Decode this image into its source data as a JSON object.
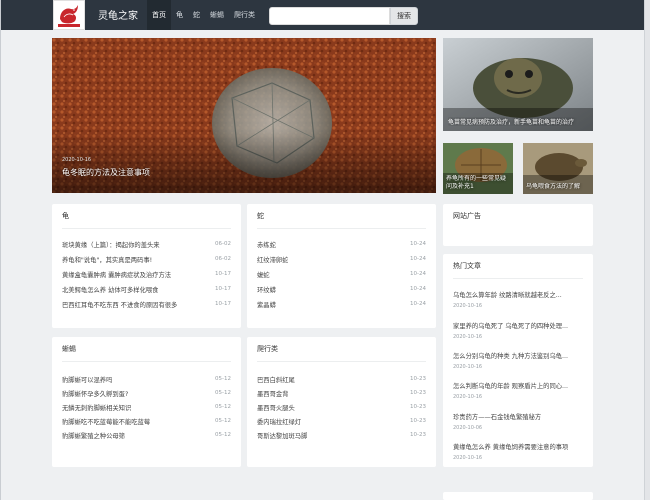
{
  "site": {
    "name": "灵龟之家",
    "logo_text": "灵龟之家"
  },
  "nav": {
    "items": [
      {
        "label": "首页",
        "active": true
      },
      {
        "label": "龟",
        "active": false
      },
      {
        "label": "蛇",
        "active": false
      },
      {
        "label": "蜥蜴",
        "active": false
      },
      {
        "label": "爬行类",
        "active": false
      }
    ]
  },
  "search": {
    "value": "",
    "placeholder": "",
    "button_label": "搜索"
  },
  "hero": {
    "date": "2020-10-16",
    "title": "龟冬眠的方法及注意事项"
  },
  "side_images": {
    "big": {
      "caption": "龟苗常见病预防及治疗，新手龟苗和龟苗的治疗"
    },
    "small_1": {
      "caption": "养龟所有的一些常见疑问及补充1"
    },
    "small_2": {
      "caption": "乌龟喂食方法的了解"
    }
  },
  "sections": {
    "turtle": {
      "title": "龟",
      "items": [
        {
          "title": "斑块黄缘（上篇）：揭起你的盖头来",
          "date": "06-02"
        },
        {
          "title": "养龟和\"说龟\"，其实真是两码事!",
          "date": "06-02"
        },
        {
          "title": "黄缘盒龟囊肿病 囊肿病症状及治疗方法",
          "date": "10-17"
        },
        {
          "title": "北美鳄龟怎么养 幼体可多样化喂食",
          "date": "10-17"
        },
        {
          "title": "巴西红耳龟不吃东西 不进食的原因有很多",
          "date": "10-17"
        }
      ]
    },
    "snake": {
      "title": "蛇",
      "items": [
        {
          "title": "赤练蛇",
          "date": "10-24"
        },
        {
          "title": "红纹滞卵蛇",
          "date": "10-24"
        },
        {
          "title": "蝮蛇",
          "date": "10-24"
        },
        {
          "title": "环纹蟒",
          "date": "10-24"
        },
        {
          "title": "紫晶蟒",
          "date": "10-24"
        }
      ]
    },
    "lizard": {
      "title": "蜥蜴",
      "items": [
        {
          "title": "豹脚蜥可以混养吗",
          "date": "05-12"
        },
        {
          "title": "豹脚蜥怀孕多久孵到蛋?",
          "date": "05-12"
        },
        {
          "title": "无鳞无刺豹脚蜥相关知识",
          "date": "05-12"
        },
        {
          "title": "豹脚蜥吃不吃蓝莓能不能吃蓝莓",
          "date": "05-12"
        },
        {
          "title": "豹脚蜥繁殖之种公母筛",
          "date": "05-12"
        }
      ]
    },
    "reptile": {
      "title": "爬行类",
      "items": [
        {
          "title": "巴西白斜红尾",
          "date": "10-23"
        },
        {
          "title": "墨西哥金背",
          "date": "10-23"
        },
        {
          "title": "墨西哥火腿头",
          "date": "10-23"
        },
        {
          "title": "委内瑞拉红绿灯",
          "date": "10-23"
        },
        {
          "title": "哥斯达黎加斑马脚",
          "date": "10-23"
        }
      ]
    }
  },
  "ads": {
    "title": "网站广告"
  },
  "hot": {
    "title": "热门文章",
    "items": [
      {
        "title": "乌龟怎么算年龄 纹路清晰就越老反之...",
        "date": "2020-10-16"
      },
      {
        "title": "家里养的乌龟死了 乌龟死了的四种处理...",
        "date": "2020-10-16"
      },
      {
        "title": "怎么分别乌龟的种类 九种方法鉴别乌龟...",
        "date": "2020-10-16"
      },
      {
        "title": "怎么判断乌龟的年龄 观察盾片上的同心...",
        "date": "2020-10-16"
      },
      {
        "title": "珍贵药方——石金钱龟繁殖秘方",
        "date": "2020-10-06"
      },
      {
        "title": "黄缘龟怎么养 黄缘龟饲养需要注意的事项",
        "date": "2020-10-16"
      }
    ]
  },
  "colors": {
    "header_bg": "#2d3640",
    "page_bg": "#eef0f2",
    "card_bg": "#ffffff",
    "muted_text": "#9aa0a6"
  }
}
